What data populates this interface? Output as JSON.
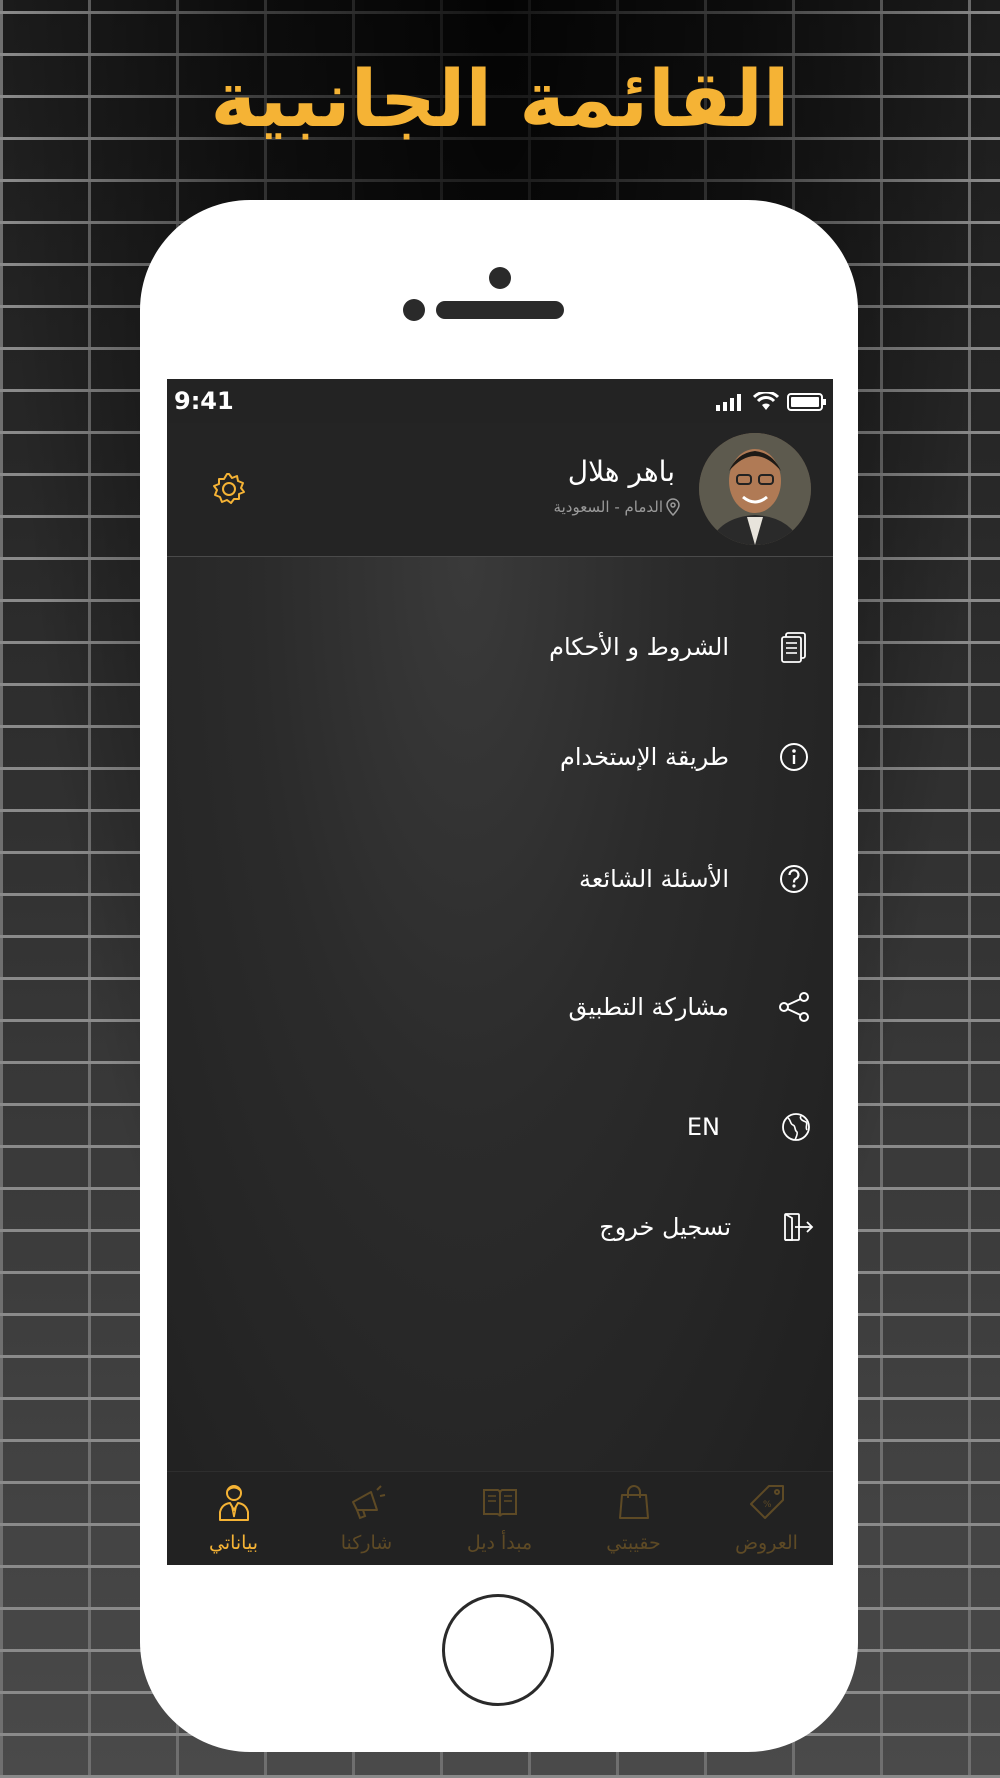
{
  "page_title": "القائمة الجانبية",
  "status_bar": {
    "time": "9:41"
  },
  "profile": {
    "name": "باهر هلال",
    "location": "الدمام - السعودية"
  },
  "menu": {
    "items": [
      {
        "label": "الشروط و الأحكام",
        "icon": "document-icon"
      },
      {
        "label": "طريقة الإستخدام",
        "icon": "info-icon"
      },
      {
        "label": "الأسئلة الشائعة",
        "icon": "question-icon"
      },
      {
        "label": "مشاركة التطبيق",
        "icon": "share-icon"
      },
      {
        "label": "EN",
        "icon": "globe-icon"
      },
      {
        "label": "تسجيل خروج",
        "icon": "logout-icon"
      }
    ]
  },
  "tabbar": {
    "tabs": [
      {
        "label": "العروض",
        "icon": "tag-icon",
        "active": false
      },
      {
        "label": "حقيبتي",
        "icon": "bag-icon",
        "active": false
      },
      {
        "label": "مبدأ ديل",
        "icon": "book-icon",
        "active": false
      },
      {
        "label": "شاركنا",
        "icon": "megaphone-icon",
        "active": false
      },
      {
        "label": "بياناتي",
        "icon": "user-icon",
        "active": true
      }
    ]
  },
  "colors": {
    "accent": "#f5b335",
    "screen_bg": "#2b2b2b",
    "inactive_tab": "#5e4a25"
  }
}
